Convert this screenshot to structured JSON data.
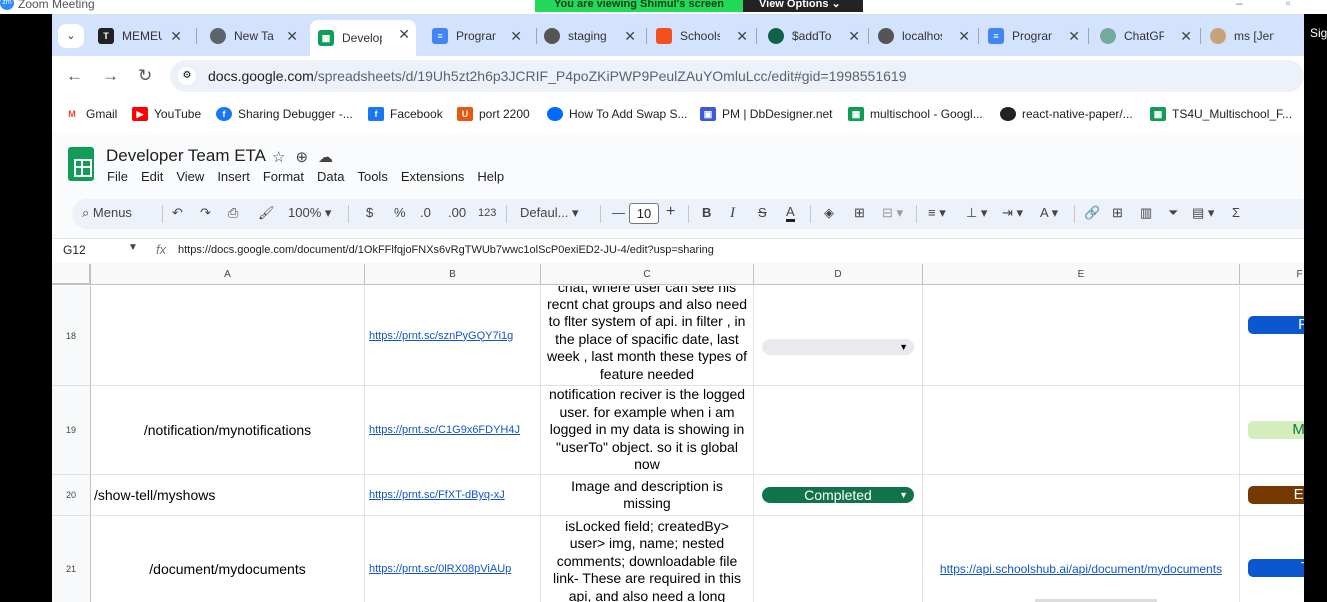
{
  "zoom": {
    "title": "Zoom Meeting",
    "banner": "You are viewing Shimul's screen",
    "view_options": "View Options"
  },
  "browser": {
    "tabs": [
      {
        "label": "MEMEU",
        "icon": "tm-icon"
      },
      {
        "label": "New Tab",
        "icon": "chrome-icon"
      },
      {
        "label": "Developer Team ETA",
        "icon": "sheets-icon"
      },
      {
        "label": "Program",
        "icon": "docs-icon"
      },
      {
        "label": "staging",
        "icon": "github-icon"
      },
      {
        "label": "Schools",
        "icon": "figma-icon"
      },
      {
        "label": "$addTo",
        "icon": "mongodb-icon"
      },
      {
        "label": "localhost",
        "icon": "github-icon"
      },
      {
        "label": "Program",
        "icon": "docs-icon"
      },
      {
        "label": "ChatGPT",
        "icon": "openai-icon"
      },
      {
        "label": "ms [Jen",
        "icon": "avatar-icon"
      }
    ],
    "profile_label": "Sig",
    "url_host": "docs.google.com",
    "url_path": "/spreadsheets/d/19Uh5zt2h6p3JCRIF_P4poZKiPWP9PeulZAuYOmluLcc/edit#gid=1998551619",
    "bookmarks": [
      "Gmail",
      "YouTube",
      "Sharing Debugger -...",
      "Facebook",
      "port 2200",
      "How To Add Swap S...",
      "PM | DbDesigner.net",
      "multischool - Googl...",
      "react-native-paper/...",
      "TS4U_Multischool_F..."
    ]
  },
  "sheet": {
    "title": "Developer Team ETA",
    "menu": [
      "File",
      "Edit",
      "View",
      "Insert",
      "Format",
      "Data",
      "Tools",
      "Extensions",
      "Help"
    ],
    "toolbar": {
      "menus_label": "Menus",
      "zoom": "100%",
      "currency": "$",
      "percent": "%",
      "dec_minus": ".0",
      "dec_plus": ".00",
      "number_format": "123",
      "font": "Defaul...",
      "font_size": "10"
    },
    "name_box": "G12",
    "formula": "https://docs.google.com/document/d/1OkFFlfqjoFNXs6vRgTWUb7wwc1olScP0exiED2-JU-4/edit?usp=sharing",
    "columns": [
      "A",
      "B",
      "C",
      "D",
      "E",
      "F"
    ],
    "rows": [
      {
        "num": "18",
        "a": "",
        "b": "https://prnt.sc/sznPyGQY7i1g",
        "c": [
          "chat, where user can see his",
          "recnt chat groups and also need",
          "to flter system of api. in filter , in",
          "the place of spacific date, last",
          "week , last month these types of",
          "feature needed"
        ],
        "d": "",
        "e": "",
        "f": "Farukh"
      },
      {
        "num": "19",
        "a": "/notification/mynotifications",
        "b": "https://prnt.sc/C1G9x6FDYH4J",
        "c": [
          "notification reciver is the logged",
          "user. for example when i am",
          "logged in my data is showing in",
          "\"userTo\" object. so it is global",
          "now"
        ],
        "d": "",
        "e": "",
        "f": "Mahmud"
      },
      {
        "num": "20",
        "a": "/show-tell/myshows",
        "b": "https://prnt.sc/FfXT-dByq-xJ",
        "c": [
          "Image and description is",
          "missing"
        ],
        "d": "Completed",
        "e": "",
        "f": "Ebrahim"
      },
      {
        "num": "21",
        "a": "/document/mydocuments",
        "b": "https://prnt.sc/0lRX08pViAUp",
        "c": [
          "isLocked field; createdBy>",
          "user> img, name; nested",
          "comments; downloadable file",
          "link- These are required in this",
          "api, and also need a long"
        ],
        "d": "",
        "e": "https://api.schoolshub.ai/api/document/mydocuments",
        "f": "Trisha"
      }
    ]
  }
}
